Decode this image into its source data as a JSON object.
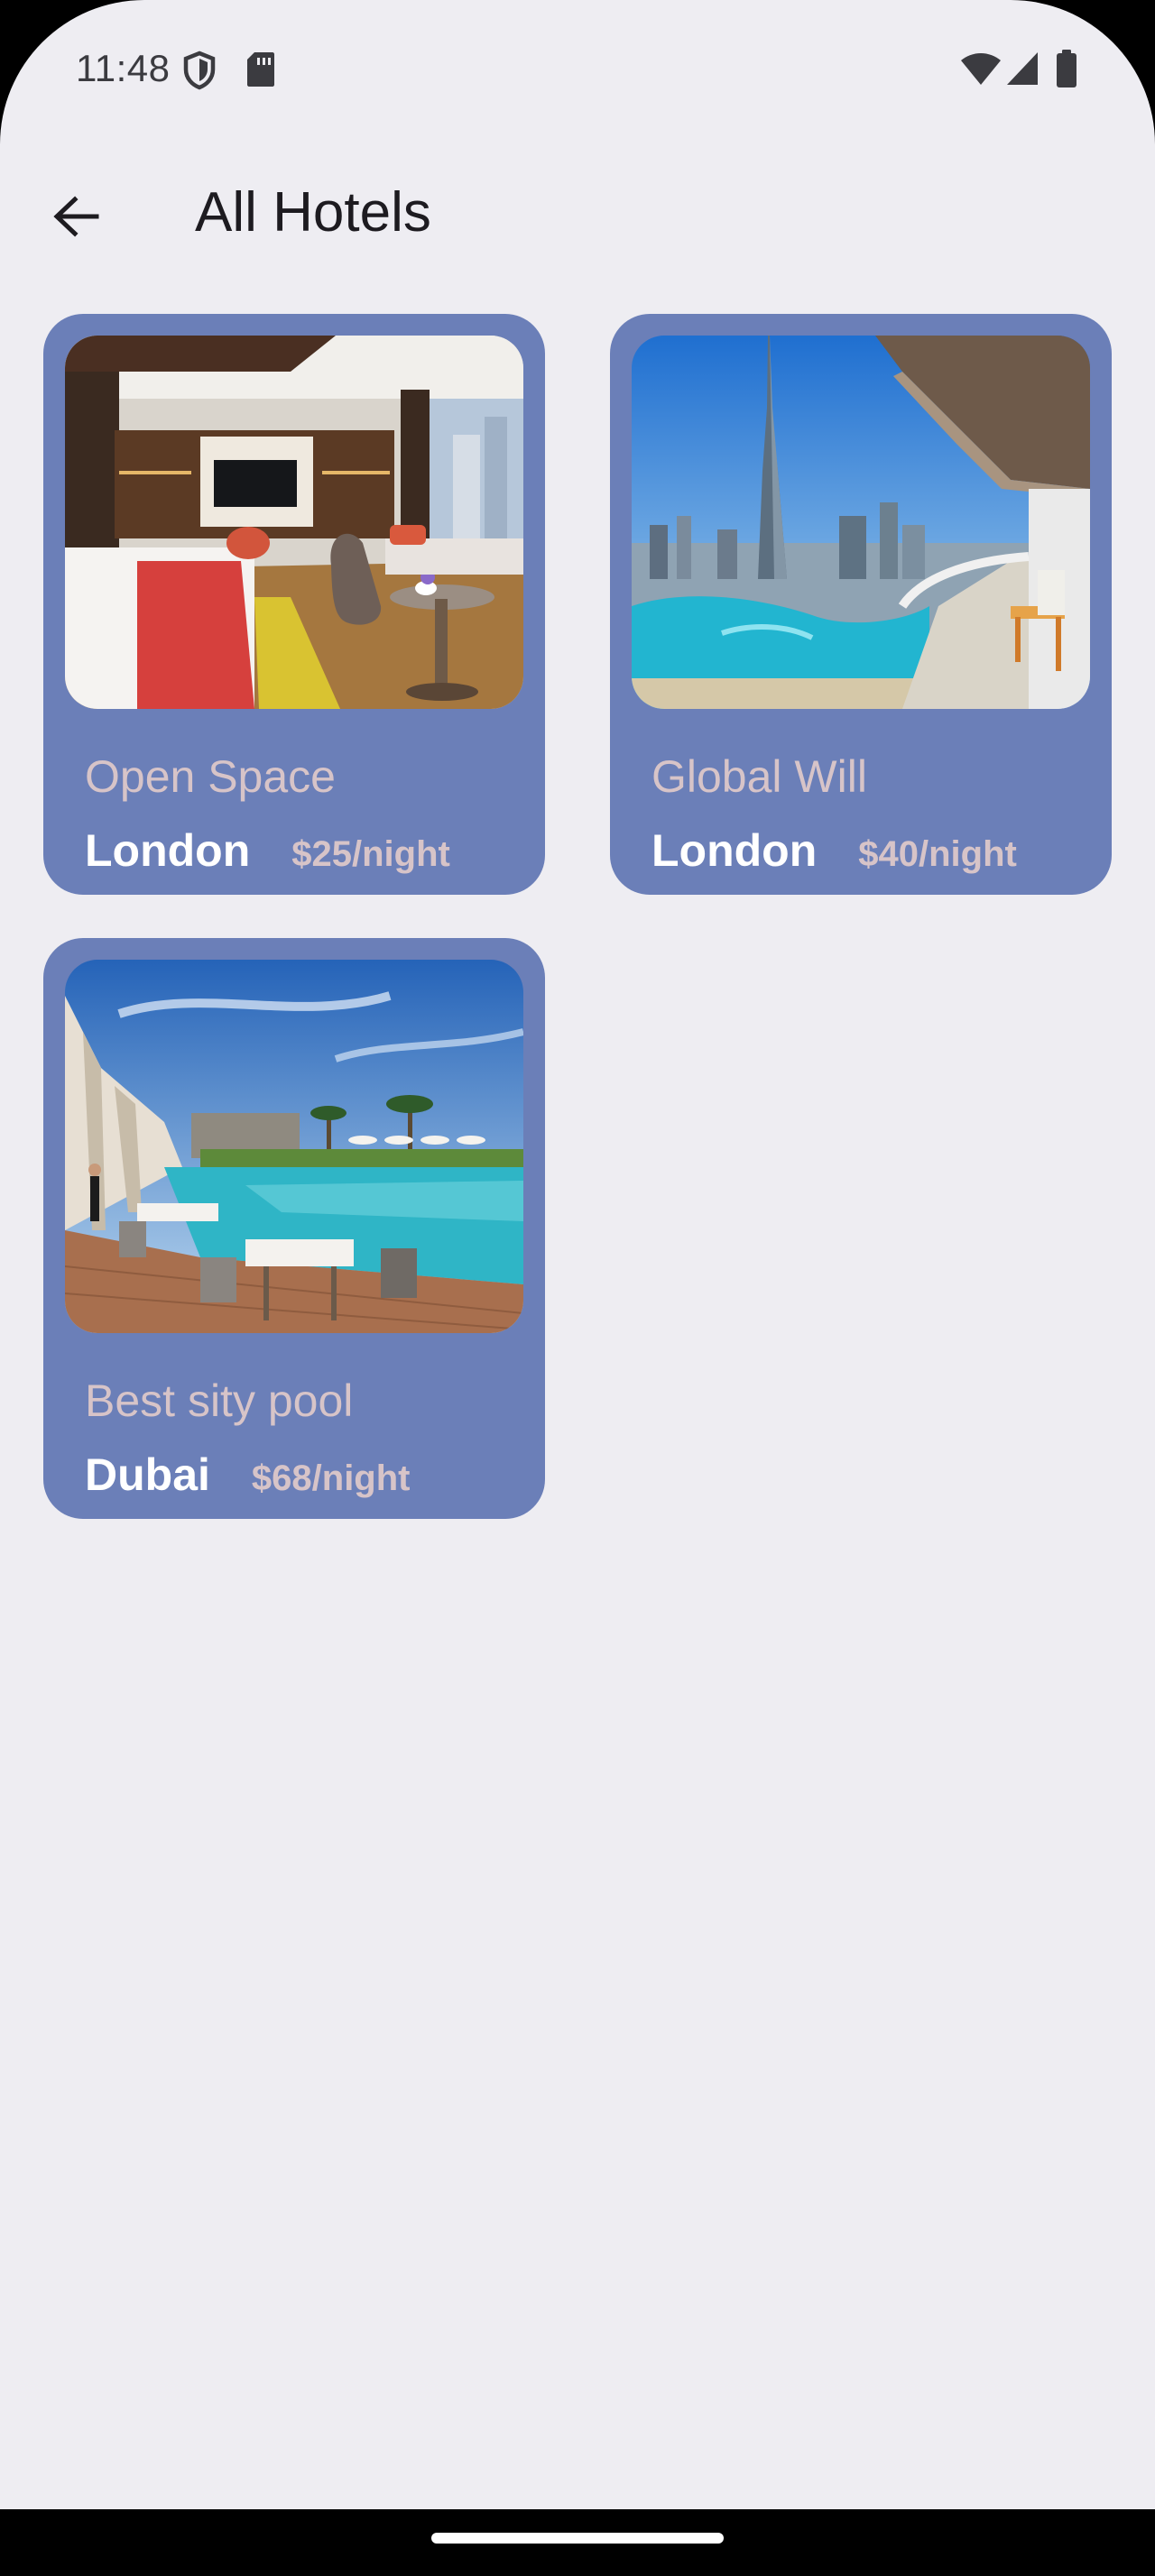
{
  "status_bar": {
    "time": "11:48",
    "icons": [
      "shield-icon",
      "sd-card-icon",
      "wifi-icon",
      "cell-signal-icon",
      "battery-icon"
    ]
  },
  "app_bar": {
    "back_icon": "arrow-back-icon",
    "title": "All Hotels"
  },
  "hotels": [
    {
      "name": "Open Space",
      "city": "London",
      "price": "$25/night",
      "image": "hotel-room-image"
    },
    {
      "name": "Global Will",
      "city": "London",
      "price": "$40/night",
      "image": "city-skyline-balcony-image"
    },
    {
      "name": "Best sity pool",
      "city": "Dubai",
      "price": "$68/night",
      "image": "pool-terrace-image"
    }
  ],
  "colors": {
    "background": "#eeedf2",
    "card": "#6b7fb8",
    "card_muted_text": "#d7c4c8",
    "card_city_text": "#ffffff"
  }
}
